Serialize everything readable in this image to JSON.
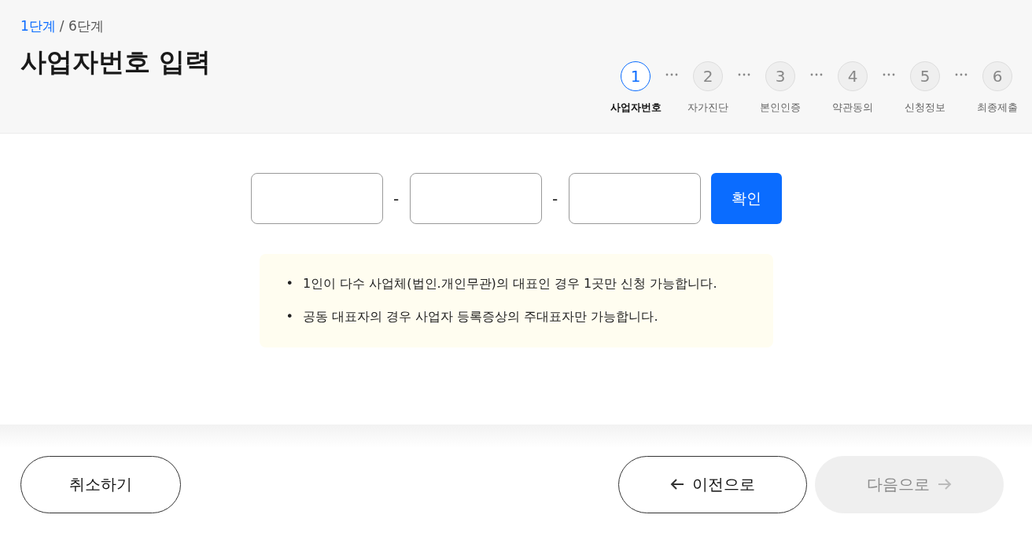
{
  "header": {
    "progress_current": "1단계",
    "progress_total": "/ 6단계",
    "title": "사업자번호 입력"
  },
  "steps": [
    {
      "number": "1",
      "label": "사업자번호",
      "selected": true
    },
    {
      "number": "2",
      "label": "자가진단",
      "selected": false
    },
    {
      "number": "3",
      "label": "본인인증",
      "selected": false
    },
    {
      "number": "4",
      "label": "약관동의",
      "selected": false
    },
    {
      "number": "5",
      "label": "신청정보",
      "selected": false
    },
    {
      "number": "6",
      "label": "최종제출",
      "selected": false
    }
  ],
  "business_number": {
    "parts": [
      {
        "kind": "input"
      },
      {
        "kind": "separator",
        "text": "-"
      },
      {
        "kind": "input"
      },
      {
        "kind": "separator",
        "text": "-"
      },
      {
        "kind": "input"
      }
    ],
    "confirm_button": "확인"
  },
  "notices": [
    {
      "bullet": "•",
      "text": "1인이 다수 사업체(법인.개인무관)의 대표인 경우 1곳만 신청 가능합니다."
    },
    {
      "bullet": "•",
      "text": "공동 대표자의 경우 사업자 등록증상의 주대표자만 가능합니다."
    }
  ],
  "footer": {
    "cancel_button": "취소하기",
    "nav_buttons": [
      {
        "kind": "prev",
        "label": "이전으로",
        "disabled": false
      },
      {
        "kind": "next",
        "label": "다음으로",
        "disabled": true
      }
    ]
  }
}
